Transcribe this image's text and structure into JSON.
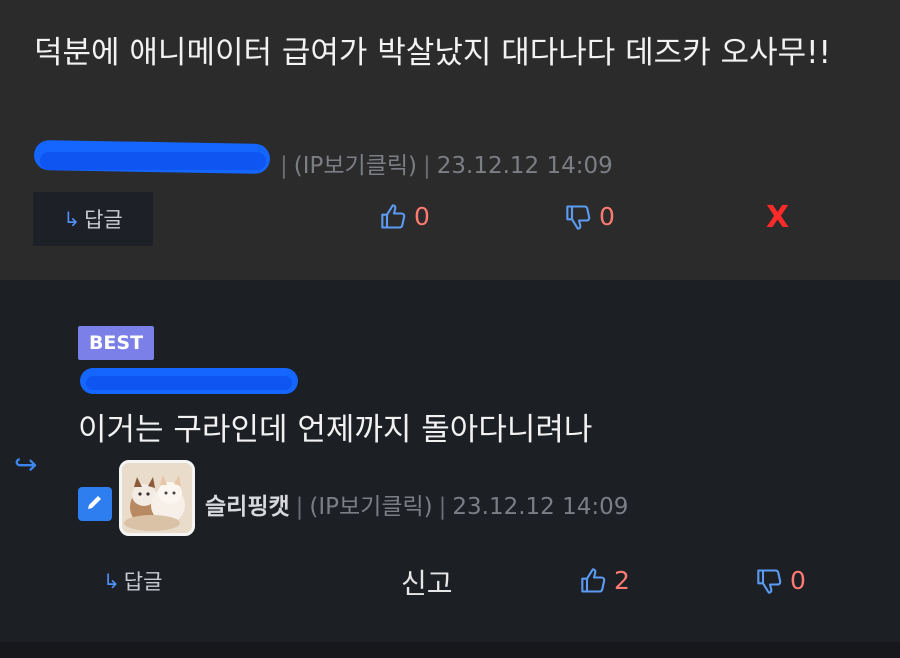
{
  "comment1": {
    "text": "덕분에 애니메이터 급여가 박살났지 대다나다 데즈카 오사무!!",
    "ip_label": "(IP보기클릭)",
    "timestamp": "23.12.12 14:09",
    "reply_label": "답글",
    "upvotes": "0",
    "downvotes": "0",
    "delete_label": "X"
  },
  "comment2": {
    "badge": "BEST",
    "text": "이거는 구라인데 언제까지 돌아다니려나",
    "username": "슬리핑캣",
    "ip_label": "(IP보기클릭)",
    "timestamp": "23.12.12 14:09",
    "reply_label": "답글",
    "report_label": "신고",
    "upvotes": "2",
    "downvotes": "0"
  },
  "colors": {
    "comment1_bg": "#2b2b2b",
    "comment2_bg": "#1c1f24",
    "accent_blue": "#3d86f0",
    "vote_count": "#ff7a72",
    "best_badge": "#7b80e8",
    "delete_red": "#ff2a2a",
    "redaction": "#1565ff"
  },
  "icons": [
    "reply-arrow-icon",
    "thumbs-up-icon",
    "thumbs-down-icon",
    "pencil-icon",
    "reply-indicator-icon",
    "cat-avatar"
  ]
}
